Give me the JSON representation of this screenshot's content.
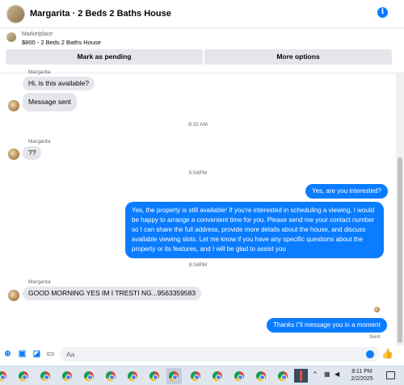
{
  "header": {
    "title": "Margarita · 2 Beds 2 Baths House",
    "info_icon": "i"
  },
  "marketplace": {
    "label": "Marketplace",
    "listing": "$800 - 2 Beds 2 Baths House",
    "mark_pending": "Mark as pending",
    "more_options": "More options"
  },
  "messages": {
    "sender1": "Margarita",
    "msg1": "Hi, is this available?",
    "msg2": "Message sent",
    "time1": "8:32 AM",
    "sender2": "Margarita",
    "msg3": "??",
    "time2": "5:54PM",
    "out1": "Yes, are you interested?",
    "out2": "Yes, the property is still available! If you're interested in scheduling a viewing, I would be happy to arrange a convenient time for you. Please send me your contact number so I can share the full address, provide more details about the house, and discuss available viewing slots. Let me know if you have any specific questions about the property or its features, and I will be glad to assist you",
    "time3": "8:04PM",
    "sender3": "Margarita",
    "msg4": "GOOD MORNING YES IM I TRESTI NG...9563359583",
    "out3": "Thanks i\"il message you in a moment",
    "sent": "Sent"
  },
  "composer": {
    "placeholder": "Aa"
  },
  "taskbar": {
    "time": "8:11 PM",
    "date": "2/2/2025"
  },
  "colors": {
    "accent": "#0a7cff",
    "bubble_in": "#e4e6eb"
  },
  "icons": [
    "info-icon",
    "plus-circle-icon",
    "photo-icon",
    "sticker-icon",
    "gif-icon",
    "emoji-icon",
    "thumbs-up-icon",
    "chrome-icon",
    "notification-icon"
  ]
}
